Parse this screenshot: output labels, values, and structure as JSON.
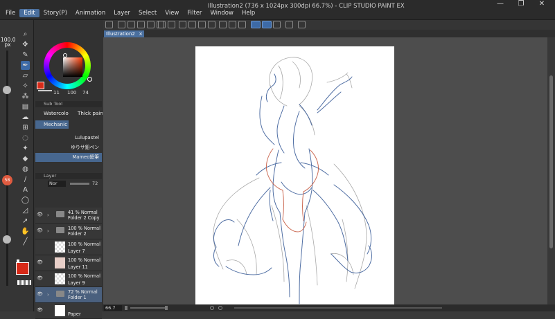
{
  "window": {
    "title": "Illustration2 (736 x 1024px 300dpi 66.7%) - CLIP STUDIO PAINT EX",
    "controls": [
      "—",
      "❐",
      "✕"
    ]
  },
  "menu": [
    "File",
    "Edit",
    "Story(P)",
    "Animation",
    "Layer",
    "Select",
    "View",
    "Filter",
    "Window",
    "Help"
  ],
  "menu_active": "Edit",
  "tabs": {
    "document": "Illustration2",
    "close": "×"
  },
  "tool_panel": {
    "brush_size": "100.0",
    "brush_size_unit": "px",
    "opacity_badge": "58",
    "main_color": "#d72a18",
    "sub_color": "#ffffff"
  },
  "color_panel": {
    "h": "11",
    "s": "100",
    "v": "74"
  },
  "subtool": {
    "header": "Sub Tool",
    "groups": [
      "Watercolor",
      "Thick paint",
      "Mechanic"
    ],
    "selected_group": "Mechanic",
    "brushes": [
      "Lulupastel",
      "ゆりサ鉛ペン",
      "Mameo鉛筆"
    ],
    "selected_brush": "Mameo鉛筆"
  },
  "layer_panel": {
    "header": "Layer",
    "blend_mode": "Nor",
    "opacity": "72",
    "layers": [
      {
        "mode": "41 % Normal",
        "name": "Folder 2 Copy",
        "type": "folder",
        "selected": false,
        "visible": true
      },
      {
        "mode": "100 % Normal",
        "name": "Folder 2",
        "type": "folder",
        "selected": false,
        "visible": true
      },
      {
        "mode": "100 % Normal",
        "name": "Layer 7",
        "type": "raster",
        "selected": false,
        "visible": false
      },
      {
        "mode": "100 % Normal",
        "name": "Layer 11",
        "type": "raster",
        "selected": false,
        "visible": true
      },
      {
        "mode": "100 % Normal",
        "name": "Layer 9",
        "type": "raster",
        "selected": false,
        "visible": true
      },
      {
        "mode": "72 % Normal",
        "name": "Folder 1",
        "type": "folder",
        "selected": true,
        "visible": true
      },
      {
        "mode": "",
        "name": "Paper",
        "type": "paper",
        "selected": false,
        "visible": true
      }
    ]
  },
  "status": {
    "zoom": "66.7"
  },
  "colors": {
    "accent": "#4a6f9e",
    "sketch_blue": "#3d5f9a",
    "sketch_red": "#c4543a",
    "sketch_gray": "#8a8a8a"
  }
}
